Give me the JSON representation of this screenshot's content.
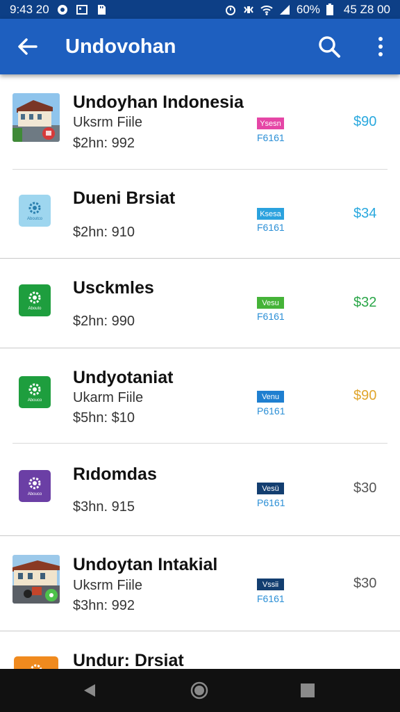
{
  "status_bar": {
    "time": "9:43 20",
    "battery": "60%",
    "clock_right": "45 Z8 00"
  },
  "app_bar": {
    "title": "Undovohan"
  },
  "list": [
    {
      "title": "Undoyhan Indonesia",
      "subtitle": "Uksrm Fiile",
      "price_line": "$2hn: 992",
      "badge": "Ysesn",
      "badge_color": "#e546a6",
      "code": "F6161",
      "amount": "$90",
      "amount_color": "#29a8de",
      "thumb": "photo-building"
    },
    {
      "title": "Dueni Brsiat",
      "subtitle": "",
      "price_line": "$2hn: 910",
      "badge": "Ksesa",
      "badge_color": "#2ba2de",
      "code": "F6161",
      "amount": "$34",
      "amount_color": "#29a8de",
      "thumb": "light-blue-app-icon"
    },
    {
      "title": "Usckmles",
      "subtitle": "",
      "price_line": "$2hn: 990",
      "badge": "Vesu",
      "badge_color": "#45b338",
      "code": "F6161",
      "amount": "$32",
      "amount_color": "#2aa648",
      "thumb": "green-app-icon"
    },
    {
      "title": "Undyotaniat",
      "subtitle": "Ukarm Fiile",
      "price_line": "$5hn: $10",
      "badge": "Venu",
      "badge_color": "#1f7fd0",
      "code": "P6161",
      "amount": "$90",
      "amount_color": "#e0a52c",
      "thumb": "green-app-icon"
    },
    {
      "title": "Rıdomdas",
      "subtitle": "",
      "price_line": "$3hn. 915",
      "badge": "Vesü",
      "badge_color": "#133e70",
      "code": "P6161",
      "amount": "$30",
      "amount_color": "#555555",
      "thumb": "purple-app-icon"
    },
    {
      "title": "Undoytan Intakial",
      "subtitle": "Uksrm Fiile",
      "price_line": "$3hn: 992",
      "badge": "Vssii",
      "badge_color": "#133e70",
      "code": "F6161",
      "amount": "$30",
      "amount_color": "#555555",
      "thumb": "photo-street"
    },
    {
      "title": "Undur: Drsiat",
      "subtitle": "",
      "price_line": "",
      "badge": "",
      "badge_color": "",
      "code": "",
      "amount": "",
      "amount_color": "",
      "thumb": "orange-app-icon"
    }
  ],
  "colors": {
    "status_bar": "#0d3f86",
    "app_bar": "#1e5fbf",
    "nav_bar": "#111111"
  }
}
